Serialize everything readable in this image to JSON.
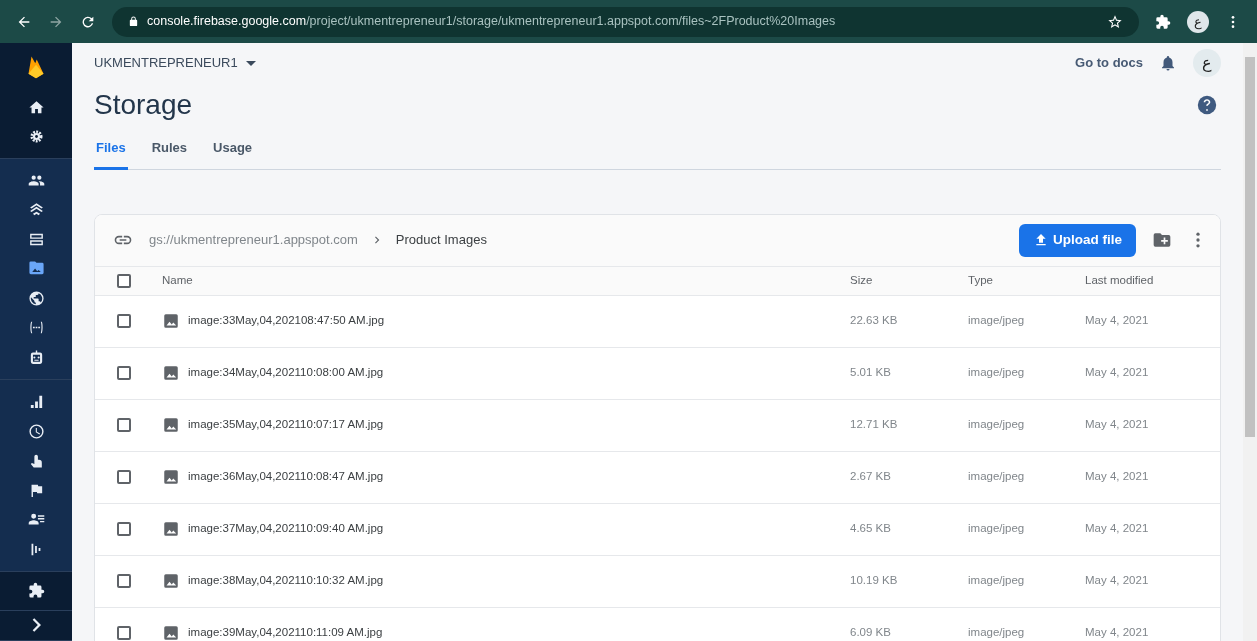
{
  "browser": {
    "url_host": "console.firebase.google.com",
    "url_path": "/project/ukmentrepreneur1/storage/ukmentrepreneur1.appspot.com/files~2FProduct%20Images",
    "avatar_letter": "ع"
  },
  "sidebar": {
    "sections": [
      {
        "items": [
          {
            "kind": "home",
            "selected": false
          },
          {
            "kind": "settings",
            "selected": false
          }
        ]
      },
      {
        "items": [
          {
            "kind": "people",
            "selected": false
          },
          {
            "kind": "layers",
            "selected": false
          },
          {
            "kind": "database",
            "selected": false
          },
          {
            "kind": "photo",
            "selected": true
          },
          {
            "kind": "globe",
            "selected": false
          },
          {
            "kind": "functions",
            "selected": false
          },
          {
            "kind": "robot",
            "selected": false
          }
        ]
      },
      {
        "items": [
          {
            "kind": "bars",
            "selected": false
          },
          {
            "kind": "clock",
            "selected": false
          },
          {
            "kind": "touch",
            "selected": false
          },
          {
            "kind": "flag",
            "selected": false
          },
          {
            "kind": "people-list",
            "selected": false
          },
          {
            "kind": "signal",
            "selected": false
          }
        ]
      },
      {
        "items": [
          {
            "kind": "puzzle",
            "selected": false
          }
        ]
      },
      {
        "items": [
          {
            "kind": "chevron",
            "selected": false
          }
        ]
      }
    ]
  },
  "header": {
    "project": "UKMENTREPRENEUR1",
    "docs_link": "Go to docs",
    "avatar_letter": "ع",
    "title": "Storage",
    "tabs": [
      {
        "label": "Files",
        "selected": true
      },
      {
        "label": "Rules",
        "selected": false
      },
      {
        "label": "Usage",
        "selected": false
      }
    ]
  },
  "bucket": {
    "path": "gs://ukmentrepreneur1.appspot.com",
    "folder": "Product Images",
    "upload_button": "Upload file"
  },
  "table": {
    "columns": [
      "Name",
      "Size",
      "Type",
      "Last modified"
    ],
    "all_checked": false,
    "rows": [
      {
        "name": "image:33May,04,202108:47:50 AM.jpg",
        "size": "22.63 KB",
        "type": "image/jpeg",
        "modified": "May 4, 2021",
        "checked": false
      },
      {
        "name": "image:34May,04,202110:08:00 AM.jpg",
        "size": "5.01 KB",
        "type": "image/jpeg",
        "modified": "May 4, 2021",
        "checked": false
      },
      {
        "name": "image:35May,04,202110:07:17 AM.jpg",
        "size": "12.71 KB",
        "type": "image/jpeg",
        "modified": "May 4, 2021",
        "checked": false
      },
      {
        "name": "image:36May,04,202110:08:47 AM.jpg",
        "size": "2.67 KB",
        "type": "image/jpeg",
        "modified": "May 4, 2021",
        "checked": false
      },
      {
        "name": "image:37May,04,202110:09:40 AM.jpg",
        "size": "4.65 KB",
        "type": "image/jpeg",
        "modified": "May 4, 2021",
        "checked": false
      },
      {
        "name": "image:38May,04,202110:10:32 AM.jpg",
        "size": "10.19 KB",
        "type": "image/jpeg",
        "modified": "May 4, 2021",
        "checked": false
      },
      {
        "name": "image:39May,04,202110:11:09 AM.jpg",
        "size": "6.09 KB",
        "type": "image/jpeg",
        "modified": "May 4, 2021",
        "checked": false
      }
    ]
  }
}
